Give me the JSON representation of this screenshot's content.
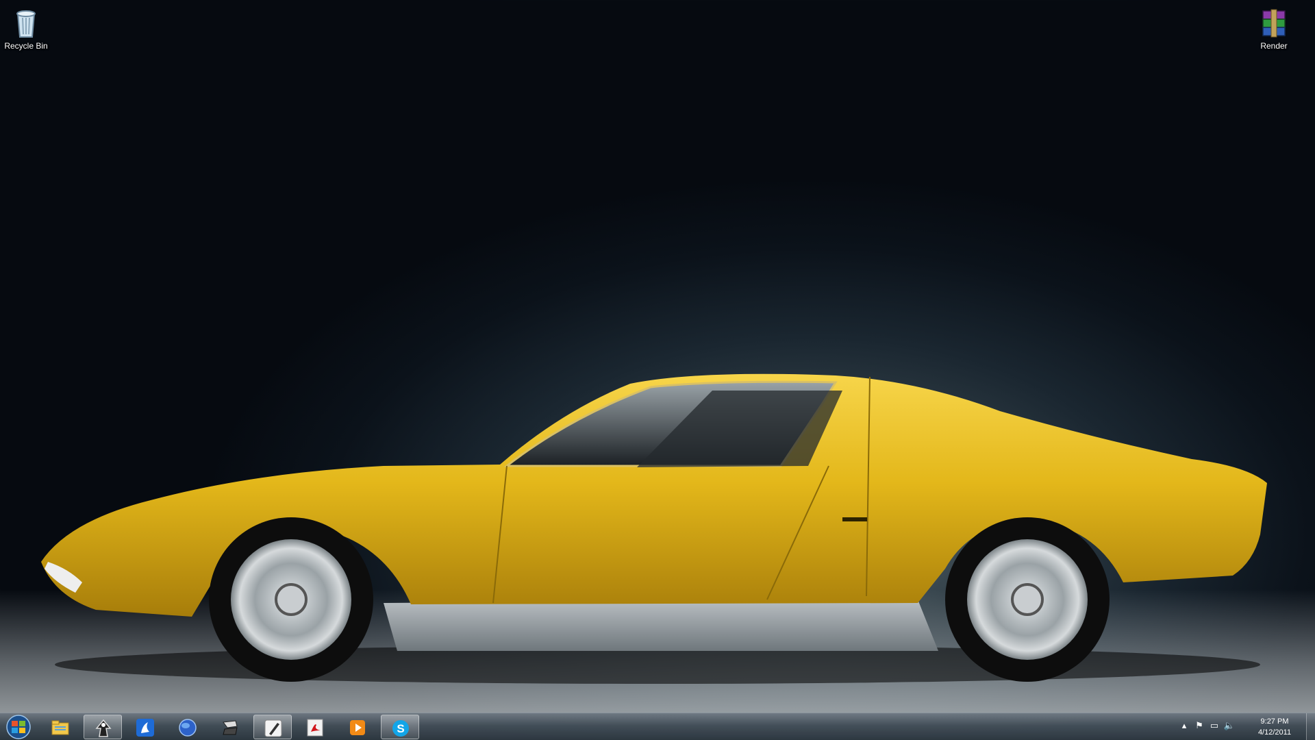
{
  "desktop": {
    "icons": [
      {
        "label": "Recycle Bin",
        "icon": "recycle-bin-icon"
      },
      {
        "label": "Render",
        "icon": "winrar-archive-icon"
      }
    ],
    "wallpaper": "yellow-sports-car"
  },
  "taskbar": {
    "start_icon": "windows-start-orb-icon",
    "pinned": [
      {
        "icon": "windows-explorer-icon",
        "active": false
      },
      {
        "icon": "inkscape-icon",
        "active": true
      },
      {
        "icon": "messenger-icon",
        "active": false
      },
      {
        "icon": "globe-browser-icon",
        "active": false
      },
      {
        "icon": "3d-app-icon",
        "active": false
      },
      {
        "icon": "pen-tool-icon",
        "active": true
      },
      {
        "icon": "acrobat-icon",
        "active": false
      },
      {
        "icon": "media-player-icon",
        "active": false
      },
      {
        "icon": "skype-icon",
        "active": true
      }
    ],
    "tray": {
      "icons": [
        "show-hidden-icons-arrow",
        "action-center-flag-icon",
        "network-icon",
        "volume-icon"
      ],
      "time": "9:27 PM",
      "date": "4/12/2011"
    }
  },
  "colors": {
    "car_body": "#e3b71a",
    "taskbar": "#4a5864"
  }
}
